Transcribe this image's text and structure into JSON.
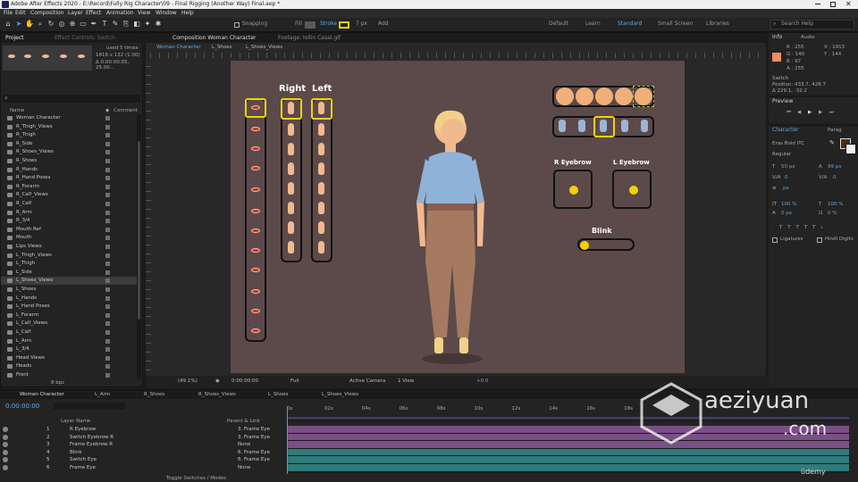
{
  "window": {
    "title": "Adobe After Effects 2020 - E:\\Record\\Fully Rig Character\\09 - Final Rigging (Another Way) Final.aep *"
  },
  "menu": [
    "File",
    "Edit",
    "Composition",
    "Layer",
    "Effect",
    "Animation",
    "View",
    "Window",
    "Help"
  ],
  "toolbar": {
    "snapping": "Snapping",
    "fill": "Fill",
    "stroke": "Stroke",
    "stroke_px": "7 px",
    "add": "Add",
    "workspaces": [
      "Default",
      "Learn",
      "Standard",
      "Small Screen",
      "Libraries"
    ],
    "search": "Search Help"
  },
  "project": {
    "tabs": [
      "Project",
      "Effect Controls: Switch"
    ],
    "info_used": "used 5 times",
    "info_size": "1818 x 132 (1.00)",
    "info_duration": "Δ 0:00:00:05, 25.00...",
    "col_name": "Name",
    "col_comment": "Comment",
    "items": [
      "Woman Character",
      "R_Thigh_Views",
      "R_Thigh",
      "R_Side",
      "R_Shoes_Views",
      "R_Shoes",
      "R_Hands",
      "R_Hand Poses",
      "R_Forarm",
      "R_Calf_Views",
      "R_Calf",
      "R_Arm",
      "R_3/4",
      "Mouth Ref",
      "Mouth",
      "Lips Views",
      "L_Thigh_Views",
      "L_Thigh",
      "L_Side",
      "L_Shoes_Views",
      "L_Shoes",
      "L_Hands",
      "L_Hand Poses",
      "L_Forarm",
      "L_Calf_Views",
      "L_Calf",
      "L_Arm",
      "L_3/4",
      "Head Views",
      "Heads",
      "Front"
    ],
    "selected": "L_Shoes_Views",
    "bpc": "8 bpc"
  },
  "composition": {
    "panel_title": "Composition Woman Character",
    "footage": "Footage: lollin Casal.gif",
    "subtabs": [
      "Woman Character",
      "L_Shoes",
      "L_Shoes_Views"
    ],
    "labels": {
      "right": "Right",
      "left": "Left",
      "r_eyebrow": "R Eyebrow",
      "l_eyebrow": "L Eyebrow",
      "blink": "Blink"
    },
    "bottom": {
      "zoom": "(49.1%)",
      "timecode": "0:00:00:00",
      "resolution": "Full",
      "camera": "Active Camera",
      "views": "1 View",
      "exposure": "+0.0"
    }
  },
  "info": {
    "tabs": [
      "Info",
      "Audio"
    ],
    "r": "R : 255",
    "g": "G : 140",
    "b": "B : 97",
    "a": "A : 255",
    "x": "X : 1913",
    "y": "Y : 144",
    "switch_label": "Switch",
    "position": "Position: 433.7, 428.7",
    "delta": "Δ 229.1, -32.2",
    "preview": "Preview",
    "swatch": "#f08c61"
  },
  "character": {
    "tabs": [
      "Character",
      "Parag"
    ],
    "font": "Eras Bold ITC",
    "style": "Regular",
    "size": "50 px",
    "leading": "99 px",
    "kerning": "0",
    "tracking": "0",
    "vscale": "100 %",
    "hscale": "100 %",
    "baseline": "0 px",
    "tsume": "0 %",
    "ligatures": "Ligatures",
    "hindi": "Hindi Digits",
    "unit": "px"
  },
  "timeline": {
    "tabs": [
      "Woman Character",
      "L_Arm",
      "R_Shoes",
      "R_Shoes_Views",
      "L_Shoes",
      "L_Shoes_Views"
    ],
    "timecode": "0:00:00:00",
    "col_layer": "Layer Name",
    "col_parent": "Parent & Link",
    "ticks": [
      "0s",
      "02s",
      "04s",
      "06s",
      "08s",
      "10s",
      "12s",
      "14s",
      "16s",
      "18s"
    ],
    "layers": [
      {
        "num": "1",
        "name": "R Eyebrow",
        "parent": "3. Frame Eye"
      },
      {
        "num": "2",
        "name": "Switch Eyebrow R",
        "parent": "3. Frame Eye"
      },
      {
        "num": "3",
        "name": "Frame Eyebrow R",
        "parent": "None"
      },
      {
        "num": "4",
        "name": "Blink",
        "parent": "6. Frame Eye"
      },
      {
        "num": "5",
        "name": "Switch Eye",
        "parent": "6. Frame Eye"
      },
      {
        "num": "6",
        "name": "Frame Eye",
        "parent": "None"
      }
    ],
    "footer": "Toggle Switches / Modes"
  },
  "watermark": {
    "brand": "aeziyuan",
    "domain": ".com",
    "udemy": "üdemy"
  }
}
